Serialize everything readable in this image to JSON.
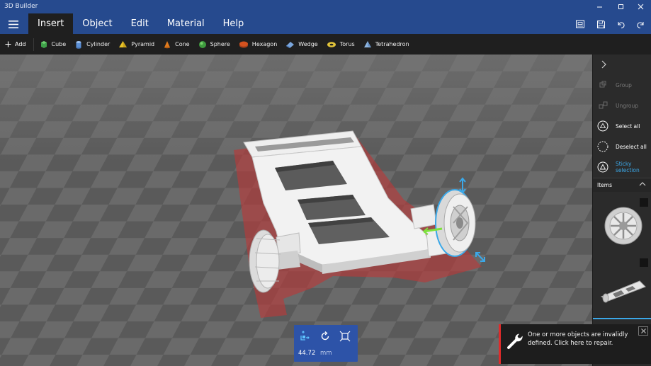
{
  "window": {
    "title": "3D Builder"
  },
  "menu": {
    "items": [
      {
        "label": "Insert",
        "active": true
      },
      {
        "label": "Object",
        "active": false
      },
      {
        "label": "Edit",
        "active": false
      },
      {
        "label": "Material",
        "active": false
      },
      {
        "label": "Help",
        "active": false
      }
    ]
  },
  "titlebar_icons": [
    "print-3d-icon",
    "save-icon",
    "undo-icon",
    "redo-icon"
  ],
  "toolbar": {
    "add_label": "Add",
    "shapes": [
      {
        "label": "Cube",
        "color": "#3fa24a"
      },
      {
        "label": "Cylinder",
        "color": "#5b8fd6"
      },
      {
        "label": "Pyramid",
        "color": "#e8c32a"
      },
      {
        "label": "Cone",
        "color": "#e07b1e"
      },
      {
        "label": "Sphere",
        "color": "#3e9a3e"
      },
      {
        "label": "Hexagon",
        "color": "#d4521f"
      },
      {
        "label": "Wedge",
        "color": "#7aa6dd"
      },
      {
        "label": "Torus",
        "color": "#e2c43a"
      },
      {
        "label": "Tetrahedron",
        "color": "#8fb6e0"
      }
    ]
  },
  "panel": {
    "group": "Group",
    "ungroup": "Ungroup",
    "select_all": "Select all",
    "deselect_all": "Deselect all",
    "sticky_selection": "Sticky selection",
    "items_header": "Items"
  },
  "transform": {
    "value": "44.72",
    "unit": "mm"
  },
  "notification": {
    "message": "One or more objects are invalidly defined. Click here to repair."
  },
  "colors": {
    "accent": "#2d53a8",
    "selection": "#3ba8e8",
    "error": "#e02b2b"
  }
}
